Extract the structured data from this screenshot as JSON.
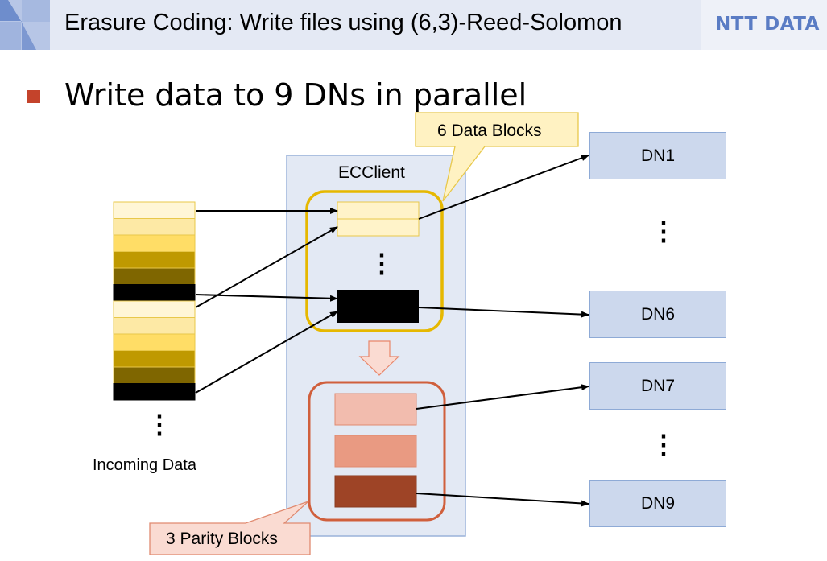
{
  "slide": {
    "title": "Erasure Coding: Write files using (6,3)-Reed-Solomon",
    "brand": "NTT DATA",
    "bullet": "Write data to 9 DNs in parallel"
  },
  "diagram": {
    "client_label": "ECClient",
    "incoming_label": "Incoming Data",
    "data_callout": "6 Data Blocks",
    "parity_callout": "3 Parity Blocks",
    "ellipsis": "⋮",
    "datanodes": [
      {
        "id": "dn1",
        "label": "DN1"
      },
      {
        "id": "dn6",
        "label": "DN6"
      },
      {
        "id": "dn7",
        "label": "DN7"
      },
      {
        "id": "dn9",
        "label": "DN9"
      }
    ],
    "incoming_stripes": [
      "#fff6d6",
      "#fde9a5",
      "#ffdd66",
      "#bf9900",
      "#7f6600",
      "#000000",
      "#fff6d6",
      "#fde9a5",
      "#ffdd66",
      "#bf9900",
      "#7f6600",
      "#000000"
    ],
    "parity_colors": [
      "#f2bcae",
      "#e99a82",
      "#9e4426"
    ],
    "colors": {
      "accent_red": "#c4432b",
      "data_group_border": "#e6b800",
      "parity_group_border": "#d05f3c",
      "client_bg": "#e3e9f4",
      "dn_bg": "#ccd8ed"
    }
  }
}
